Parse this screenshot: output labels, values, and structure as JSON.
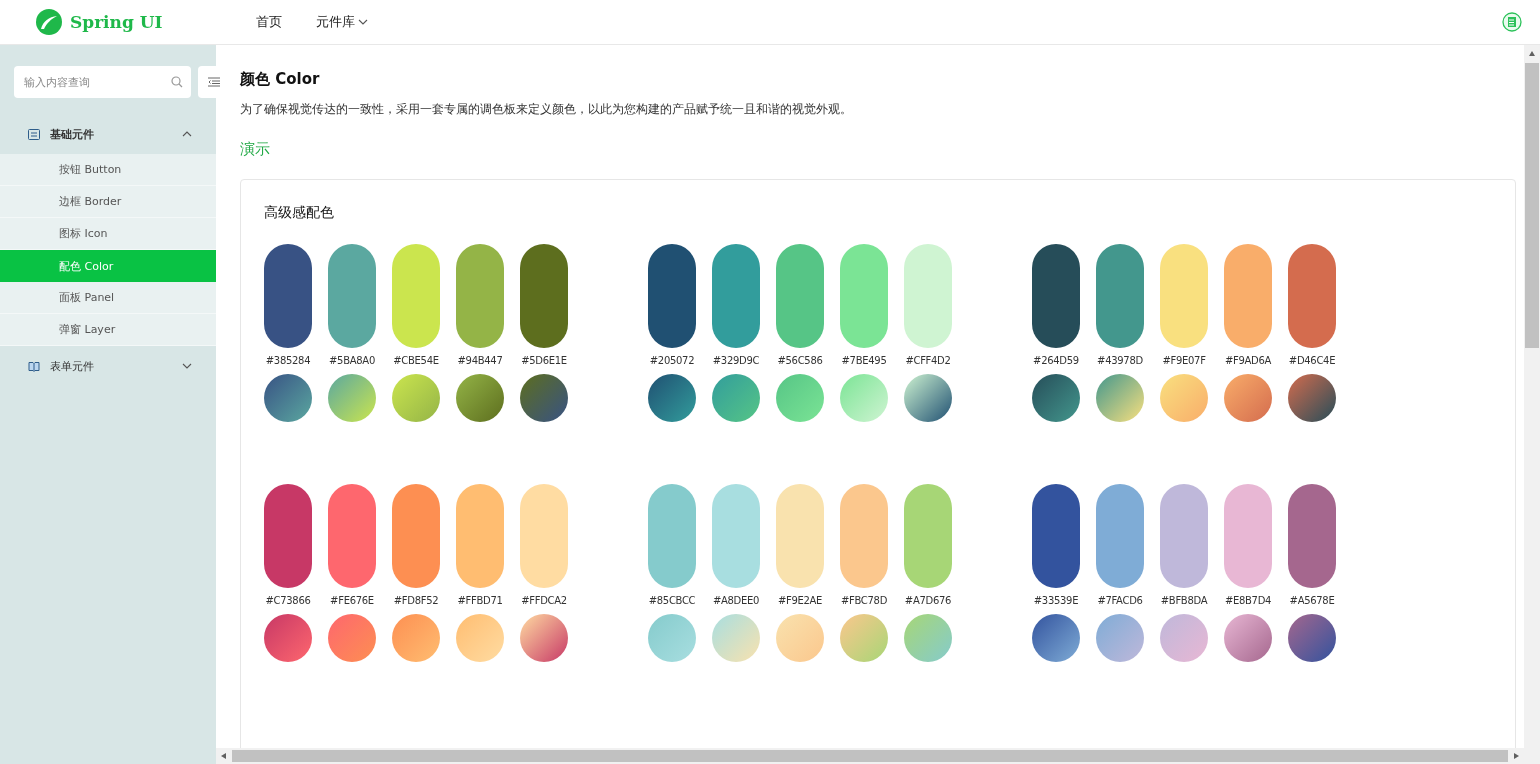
{
  "header": {
    "logo_text": "Spring UI",
    "nav": [
      {
        "label": "首页",
        "dropdown": false
      },
      {
        "label": "元件库",
        "dropdown": true
      }
    ]
  },
  "sidebar": {
    "search": {
      "placeholder": "输入内容查询"
    },
    "groups": [
      {
        "label": "基础元件",
        "expanded": true,
        "children": [
          {
            "label": "按钮 Button",
            "selected": false
          },
          {
            "label": "边框 Border",
            "selected": false
          },
          {
            "label": "图标 Icon",
            "selected": false
          },
          {
            "label": "配色 Color",
            "selected": true
          },
          {
            "label": "面板 Panel",
            "selected": false
          },
          {
            "label": "弹窗 Layer",
            "selected": false
          }
        ]
      },
      {
        "label": "表单元件",
        "expanded": false
      }
    ]
  },
  "page": {
    "title": "颜色 Color",
    "description": "为了确保视觉传达的一致性，采用一套专属的调色板来定义颜色，以此为您构建的产品赋予统一且和谐的视觉外观。",
    "demo_label": "演示"
  },
  "card": {
    "title": "高级感配色",
    "palettes": [
      {
        "swatches": [
          {
            "label": "#385284",
            "color": "#385284"
          },
          {
            "label": "#5BA8A0",
            "color": "#5ba8a0"
          },
          {
            "label": "#CBE54E",
            "color": "#cbe54e"
          },
          {
            "label": "#94B447",
            "color": "#94b447"
          },
          {
            "label": "#5D6E1E",
            "color": "#5d6e1e"
          }
        ]
      },
      {
        "swatches": [
          {
            "label": "#205072",
            "color": "#205072"
          },
          {
            "label": "#329D9C",
            "color": "#329d9c"
          },
          {
            "label": "#56C586",
            "color": "#56c586"
          },
          {
            "label": "#7BE495",
            "color": "#7be495"
          },
          {
            "label": "#CFF4D2",
            "color": "#cff4d2"
          }
        ]
      },
      {
        "swatches": [
          {
            "label": "#264D59",
            "color": "#264d59"
          },
          {
            "label": "#43978D",
            "color": "#43978d"
          },
          {
            "label": "#F9E07F",
            "color": "#f9e07f"
          },
          {
            "label": "#F9AD6A",
            "color": "#f9ad6a"
          },
          {
            "label": "#D46C4E",
            "color": "#d46c4e"
          }
        ]
      },
      {
        "swatches": [
          {
            "label": "#C73866",
            "color": "#c73866"
          },
          {
            "label": "#FE676E",
            "color": "#fe676e"
          },
          {
            "label": "#FD8F52",
            "color": "#fd8f52"
          },
          {
            "label": "#FFBD71",
            "color": "#ffbd71"
          },
          {
            "label": "#FFDCA2",
            "color": "#ffdca2"
          }
        ]
      },
      {
        "swatches": [
          {
            "label": "#85CBCC",
            "color": "#85cbcc"
          },
          {
            "label": "#A8DEE0",
            "color": "#a8dee0"
          },
          {
            "label": "#F9E2AE",
            "color": "#f9e2ae"
          },
          {
            "label": "#FBC78D",
            "color": "#fbc78d"
          },
          {
            "label": "#A7D676",
            "color": "#a7d676"
          }
        ]
      },
      {
        "swatches": [
          {
            "label": "#33539E",
            "color": "#33539e"
          },
          {
            "label": "#7FACD6",
            "color": "#7facd6"
          },
          {
            "label": "#BFB8DA",
            "color": "#bfb8da"
          },
          {
            "label": "#E8B7D4",
            "color": "#e8b7d4"
          },
          {
            "label": "#A5678E",
            "color": "#a5678e"
          }
        ]
      }
    ]
  }
}
